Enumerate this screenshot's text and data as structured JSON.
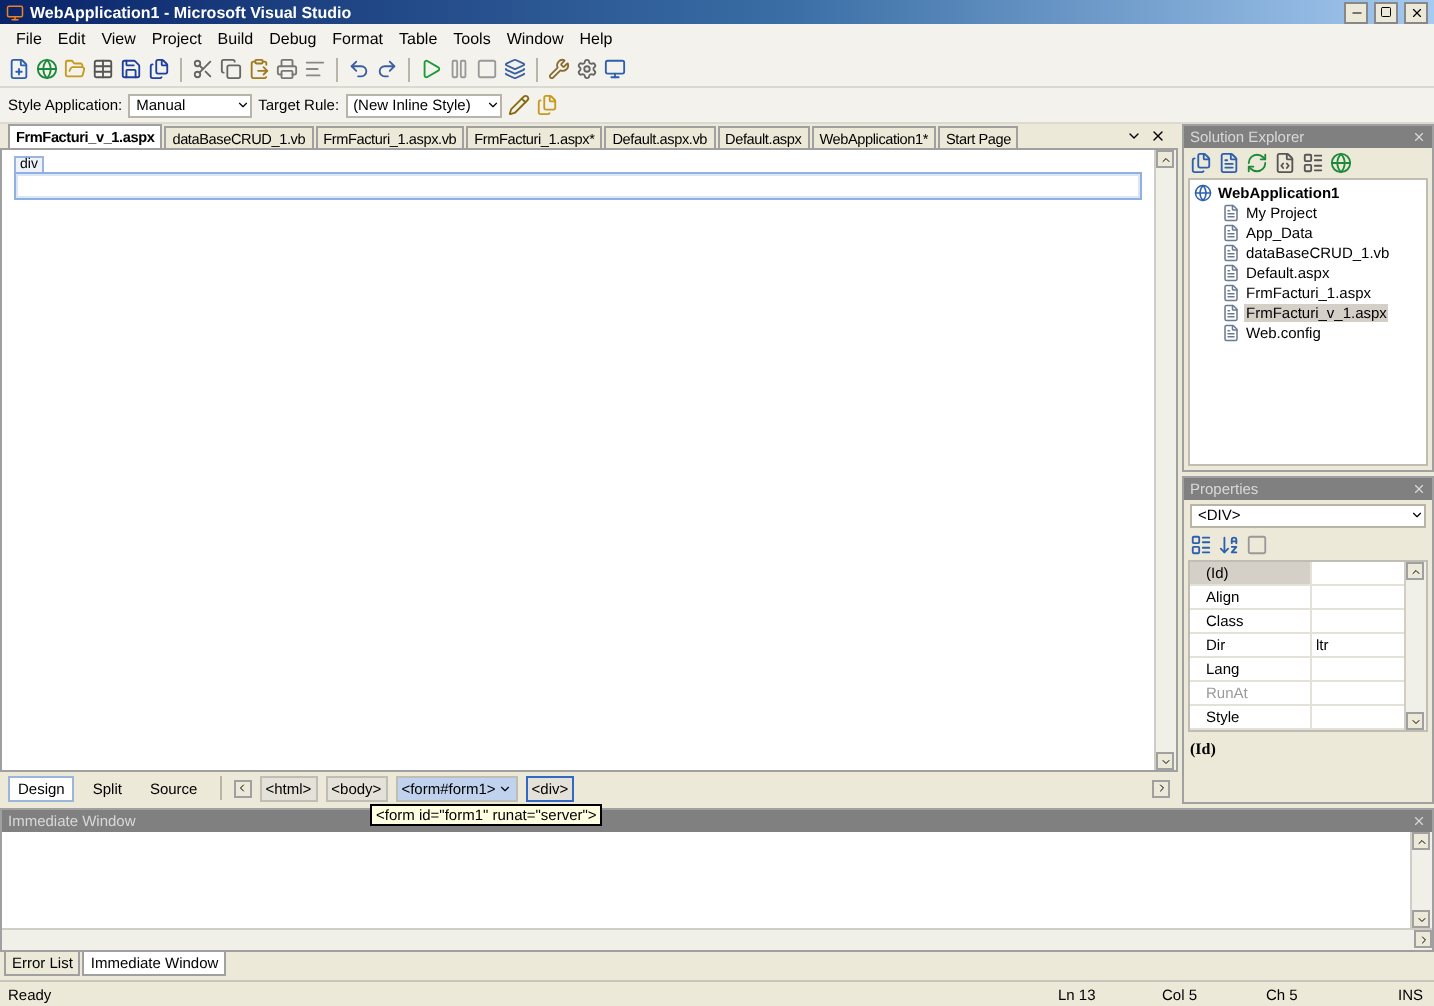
{
  "window": {
    "title": "WebApplication1 - Microsoft Visual Studio"
  },
  "menu": [
    "File",
    "Edit",
    "View",
    "Project",
    "Build",
    "Debug",
    "Format",
    "Table",
    "Tools",
    "Window",
    "Help"
  ],
  "style_toolbar": {
    "style_application_label": "Style Application:",
    "style_application_value": "Manual",
    "target_rule_label": "Target Rule:",
    "target_rule_value": "(New Inline Style)"
  },
  "doc_tabs": [
    {
      "label": "FrmFacturi_v_1.aspx",
      "selected": true
    },
    {
      "label": "dataBaseCRUD_1.vb",
      "selected": false
    },
    {
      "label": "FrmFacturi_1.aspx.vb",
      "selected": false
    },
    {
      "label": "FrmFacturi_1.aspx*",
      "selected": false
    },
    {
      "label": "Default.aspx.vb",
      "selected": false
    },
    {
      "label": "Default.aspx",
      "selected": false
    },
    {
      "label": "WebApplication1*",
      "selected": false
    },
    {
      "label": "Start Page",
      "selected": false
    }
  ],
  "designer": {
    "element_tag": "div"
  },
  "view_tabs": [
    {
      "label": "Design",
      "selected": true
    },
    {
      "label": "Split",
      "selected": false
    },
    {
      "label": "Source",
      "selected": false
    }
  ],
  "tag_path": [
    {
      "label": "<html>",
      "selected": false,
      "hovered": false
    },
    {
      "label": "<body>",
      "selected": false,
      "hovered": false
    },
    {
      "label": "<form#form1>",
      "selected": false,
      "hovered": true
    },
    {
      "label": "<div>",
      "selected": true,
      "hovered": false
    }
  ],
  "tooltip": "<form id=\"form1\" runat=\"server\">",
  "solution_explorer": {
    "title": "Solution Explorer",
    "root": "WebApplication1",
    "children": [
      {
        "label": "My Project",
        "selected": false
      },
      {
        "label": "App_Data",
        "selected": false
      },
      {
        "label": "dataBaseCRUD_1.vb",
        "selected": false
      },
      {
        "label": "Default.aspx",
        "selected": false
      },
      {
        "label": "FrmFacturi_1.aspx",
        "selected": false
      },
      {
        "label": "FrmFacturi_v_1.aspx",
        "selected": true
      },
      {
        "label": "Web.config",
        "selected": false
      }
    ]
  },
  "properties": {
    "title": "Properties",
    "object": "<DIV>",
    "rows": [
      {
        "name": "(Id)",
        "selected": true,
        "disabled": false
      },
      {
        "name": "Align",
        "selected": false,
        "disabled": false
      },
      {
        "name": "Class",
        "selected": false,
        "disabled": false
      },
      {
        "name": "Dir",
        "value": "ltr",
        "selected": false,
        "disabled": false
      },
      {
        "name": "Lang",
        "selected": false,
        "disabled": false
      },
      {
        "name": "RunAt",
        "selected": false,
        "disabled": true
      },
      {
        "name": "Style",
        "selected": false,
        "disabled": false
      }
    ],
    "description": "(Id)"
  },
  "immediate_window": {
    "title": "Immediate Window"
  },
  "bottom_tabs": [
    {
      "label": "Error List",
      "selected": false
    },
    {
      "label": "Immediate Window",
      "selected": true
    }
  ],
  "status_bar": {
    "message": "Ready",
    "line": "Ln 13",
    "column": "Col 5",
    "char": "Ch 5",
    "mode": "INS"
  }
}
